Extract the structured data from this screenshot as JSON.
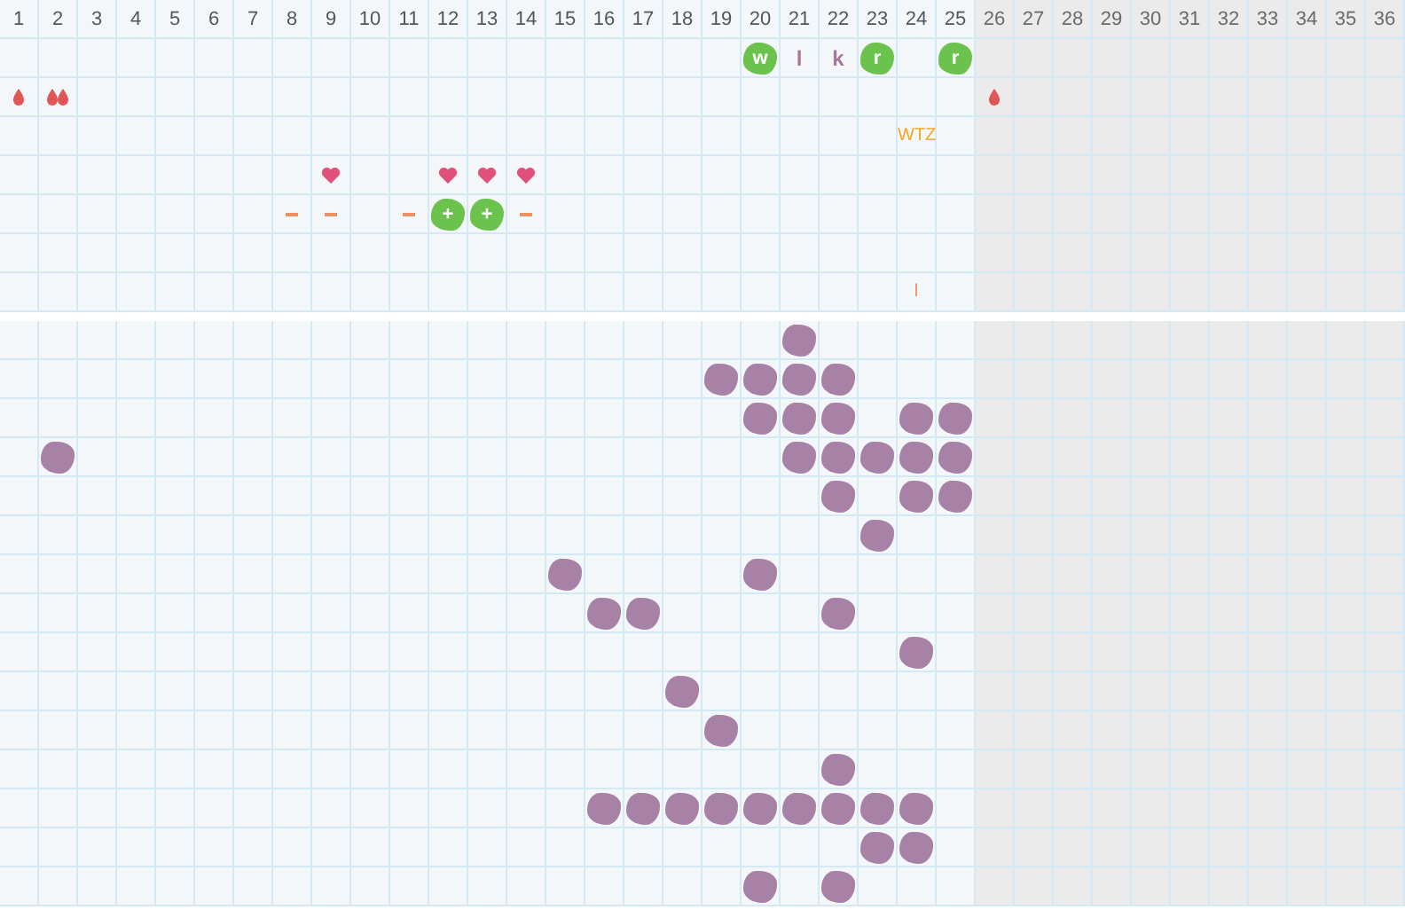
{
  "days": [
    {
      "label": "1",
      "future": false
    },
    {
      "label": "2",
      "future": false
    },
    {
      "label": "3",
      "future": false
    },
    {
      "label": "4",
      "future": false
    },
    {
      "label": "5",
      "future": false
    },
    {
      "label": "6",
      "future": false
    },
    {
      "label": "7",
      "future": false
    },
    {
      "label": "8",
      "future": false
    },
    {
      "label": "9",
      "future": false
    },
    {
      "label": "10",
      "future": false
    },
    {
      "label": "11",
      "future": false
    },
    {
      "label": "12",
      "future": false
    },
    {
      "label": "13",
      "future": false
    },
    {
      "label": "14",
      "future": false
    },
    {
      "label": "15",
      "future": false
    },
    {
      "label": "16",
      "future": false
    },
    {
      "label": "17",
      "future": false
    },
    {
      "label": "18",
      "future": false
    },
    {
      "label": "19",
      "future": false
    },
    {
      "label": "20",
      "future": false
    },
    {
      "label": "21",
      "future": false
    },
    {
      "label": "22",
      "future": false
    },
    {
      "label": "23",
      "future": false
    },
    {
      "label": "24",
      "future": false
    },
    {
      "label": "25",
      "future": false
    },
    {
      "label": "26",
      "future": true
    },
    {
      "label": "27",
      "future": true
    },
    {
      "label": "28",
      "future": true
    },
    {
      "label": "29",
      "future": true
    },
    {
      "label": "30",
      "future": true
    },
    {
      "label": "31",
      "future": true
    },
    {
      "label": "32",
      "future": true
    },
    {
      "label": "33",
      "future": true
    },
    {
      "label": "34",
      "future": true
    },
    {
      "label": "35",
      "future": true
    },
    {
      "label": "36",
      "future": true
    }
  ],
  "top_rows": [
    [
      null,
      null,
      null,
      null,
      null,
      null,
      null,
      null,
      null,
      null,
      null,
      null,
      null,
      null,
      null,
      null,
      null,
      null,
      null,
      {
        "kind": "badge",
        "text": "w"
      },
      {
        "kind": "letter",
        "text": "l"
      },
      {
        "kind": "letter",
        "text": "k"
      },
      {
        "kind": "badge",
        "text": "r"
      },
      null,
      {
        "kind": "badge",
        "text": "r"
      },
      null,
      null,
      null,
      null,
      null,
      null,
      null,
      null,
      null,
      null,
      null
    ],
    [
      {
        "kind": "drop"
      },
      {
        "kind": "double-drop"
      },
      null,
      null,
      null,
      null,
      null,
      null,
      null,
      null,
      null,
      null,
      null,
      null,
      null,
      null,
      null,
      null,
      null,
      null,
      null,
      null,
      null,
      null,
      null,
      {
        "kind": "drop"
      },
      null,
      null,
      null,
      null,
      null,
      null,
      null,
      null,
      null,
      null
    ],
    [
      null,
      null,
      null,
      null,
      null,
      null,
      null,
      null,
      null,
      null,
      null,
      null,
      null,
      null,
      null,
      null,
      null,
      null,
      null,
      null,
      null,
      null,
      null,
      {
        "kind": "note",
        "text": "WTZ"
      },
      null,
      null,
      null,
      null,
      null,
      null,
      null,
      null,
      null,
      null,
      null,
      null
    ],
    [
      null,
      null,
      null,
      null,
      null,
      null,
      null,
      null,
      {
        "kind": "heart"
      },
      null,
      null,
      {
        "kind": "heart"
      },
      {
        "kind": "heart"
      },
      {
        "kind": "heart"
      },
      null,
      null,
      null,
      null,
      null,
      null,
      null,
      null,
      null,
      null,
      null,
      null,
      null,
      null,
      null,
      null,
      null,
      null,
      null,
      null,
      null,
      null
    ],
    [
      null,
      null,
      null,
      null,
      null,
      null,
      null,
      {
        "kind": "dash"
      },
      {
        "kind": "dash"
      },
      null,
      {
        "kind": "dash"
      },
      {
        "kind": "badge",
        "text": "+"
      },
      {
        "kind": "badge",
        "text": "+"
      },
      {
        "kind": "dash"
      },
      null,
      null,
      null,
      null,
      null,
      null,
      null,
      null,
      null,
      null,
      null,
      null,
      null,
      null,
      null,
      null,
      null,
      null,
      null,
      null,
      null,
      null
    ],
    [
      null,
      null,
      null,
      null,
      null,
      null,
      null,
      null,
      null,
      null,
      null,
      null,
      null,
      null,
      null,
      null,
      null,
      null,
      null,
      null,
      null,
      null,
      null,
      null,
      null,
      null,
      null,
      null,
      null,
      null,
      null,
      null,
      null,
      null,
      null,
      null
    ],
    [
      null,
      null,
      null,
      null,
      null,
      null,
      null,
      null,
      null,
      null,
      null,
      null,
      null,
      null,
      null,
      null,
      null,
      null,
      null,
      null,
      null,
      null,
      null,
      {
        "kind": "note",
        "text": "l"
      },
      null,
      null,
      null,
      null,
      null,
      null,
      null,
      null,
      null,
      null,
      null,
      null
    ]
  ],
  "bottom_rows": [
    [
      null,
      null,
      null,
      null,
      null,
      null,
      null,
      null,
      null,
      null,
      null,
      null,
      null,
      null,
      null,
      null,
      null,
      null,
      null,
      null,
      {
        "kind": "scribble"
      },
      null,
      null,
      null,
      null,
      null,
      null,
      null,
      null,
      null,
      null,
      null,
      null,
      null,
      null,
      null
    ],
    [
      null,
      null,
      null,
      null,
      null,
      null,
      null,
      null,
      null,
      null,
      null,
      null,
      null,
      null,
      null,
      null,
      null,
      null,
      {
        "kind": "scribble"
      },
      {
        "kind": "scribble"
      },
      {
        "kind": "scribble"
      },
      {
        "kind": "scribble"
      },
      null,
      null,
      null,
      null,
      null,
      null,
      null,
      null,
      null,
      null,
      null,
      null,
      null,
      null
    ],
    [
      null,
      null,
      null,
      null,
      null,
      null,
      null,
      null,
      null,
      null,
      null,
      null,
      null,
      null,
      null,
      null,
      null,
      null,
      null,
      {
        "kind": "scribble"
      },
      {
        "kind": "scribble"
      },
      {
        "kind": "scribble"
      },
      null,
      {
        "kind": "scribble"
      },
      {
        "kind": "scribble"
      },
      null,
      null,
      null,
      null,
      null,
      null,
      null,
      null,
      null,
      null,
      null
    ],
    [
      null,
      {
        "kind": "scribble"
      },
      null,
      null,
      null,
      null,
      null,
      null,
      null,
      null,
      null,
      null,
      null,
      null,
      null,
      null,
      null,
      null,
      null,
      null,
      {
        "kind": "scribble"
      },
      {
        "kind": "scribble"
      },
      {
        "kind": "scribble"
      },
      {
        "kind": "scribble"
      },
      {
        "kind": "scribble"
      },
      null,
      null,
      null,
      null,
      null,
      null,
      null,
      null,
      null,
      null,
      null
    ],
    [
      null,
      null,
      null,
      null,
      null,
      null,
      null,
      null,
      null,
      null,
      null,
      null,
      null,
      null,
      null,
      null,
      null,
      null,
      null,
      null,
      null,
      {
        "kind": "scribble"
      },
      null,
      {
        "kind": "scribble"
      },
      {
        "kind": "scribble"
      },
      null,
      null,
      null,
      null,
      null,
      null,
      null,
      null,
      null,
      null,
      null
    ],
    [
      null,
      null,
      null,
      null,
      null,
      null,
      null,
      null,
      null,
      null,
      null,
      null,
      null,
      null,
      null,
      null,
      null,
      null,
      null,
      null,
      null,
      null,
      {
        "kind": "scribble"
      },
      null,
      null,
      null,
      null,
      null,
      null,
      null,
      null,
      null,
      null,
      null,
      null,
      null
    ],
    [
      null,
      null,
      null,
      null,
      null,
      null,
      null,
      null,
      null,
      null,
      null,
      null,
      null,
      null,
      {
        "kind": "scribble"
      },
      null,
      null,
      null,
      null,
      {
        "kind": "scribble"
      },
      null,
      null,
      null,
      null,
      null,
      null,
      null,
      null,
      null,
      null,
      null,
      null,
      null,
      null,
      null,
      null
    ],
    [
      null,
      null,
      null,
      null,
      null,
      null,
      null,
      null,
      null,
      null,
      null,
      null,
      null,
      null,
      null,
      {
        "kind": "scribble"
      },
      {
        "kind": "scribble"
      },
      null,
      null,
      null,
      null,
      {
        "kind": "scribble"
      },
      null,
      null,
      null,
      null,
      null,
      null,
      null,
      null,
      null,
      null,
      null,
      null,
      null,
      null
    ],
    [
      null,
      null,
      null,
      null,
      null,
      null,
      null,
      null,
      null,
      null,
      null,
      null,
      null,
      null,
      null,
      null,
      null,
      null,
      null,
      null,
      null,
      null,
      null,
      {
        "kind": "scribble"
      },
      null,
      null,
      null,
      null,
      null,
      null,
      null,
      null,
      null,
      null,
      null,
      null
    ],
    [
      null,
      null,
      null,
      null,
      null,
      null,
      null,
      null,
      null,
      null,
      null,
      null,
      null,
      null,
      null,
      null,
      null,
      {
        "kind": "scribble"
      },
      null,
      null,
      null,
      null,
      null,
      null,
      null,
      null,
      null,
      null,
      null,
      null,
      null,
      null,
      null,
      null,
      null,
      null
    ],
    [
      null,
      null,
      null,
      null,
      null,
      null,
      null,
      null,
      null,
      null,
      null,
      null,
      null,
      null,
      null,
      null,
      null,
      null,
      {
        "kind": "scribble"
      },
      null,
      null,
      null,
      null,
      null,
      null,
      null,
      null,
      null,
      null,
      null,
      null,
      null,
      null,
      null,
      null,
      null
    ],
    [
      null,
      null,
      null,
      null,
      null,
      null,
      null,
      null,
      null,
      null,
      null,
      null,
      null,
      null,
      null,
      null,
      null,
      null,
      null,
      null,
      null,
      {
        "kind": "scribble"
      },
      null,
      null,
      null,
      null,
      null,
      null,
      null,
      null,
      null,
      null,
      null,
      null,
      null,
      null
    ],
    [
      null,
      null,
      null,
      null,
      null,
      null,
      null,
      null,
      null,
      null,
      null,
      null,
      null,
      null,
      null,
      {
        "kind": "scribble"
      },
      {
        "kind": "scribble"
      },
      {
        "kind": "scribble"
      },
      {
        "kind": "scribble"
      },
      {
        "kind": "scribble"
      },
      {
        "kind": "scribble"
      },
      {
        "kind": "scribble"
      },
      {
        "kind": "scribble"
      },
      {
        "kind": "scribble"
      },
      null,
      null,
      null,
      null,
      null,
      null,
      null,
      null,
      null,
      null,
      null,
      null
    ],
    [
      null,
      null,
      null,
      null,
      null,
      null,
      null,
      null,
      null,
      null,
      null,
      null,
      null,
      null,
      null,
      null,
      null,
      null,
      null,
      null,
      null,
      null,
      {
        "kind": "scribble"
      },
      {
        "kind": "scribble"
      },
      null,
      null,
      null,
      null,
      null,
      null,
      null,
      null,
      null,
      null,
      null,
      null
    ],
    [
      null,
      null,
      null,
      null,
      null,
      null,
      null,
      null,
      null,
      null,
      null,
      null,
      null,
      null,
      null,
      null,
      null,
      null,
      null,
      {
        "kind": "scribble"
      },
      null,
      {
        "kind": "scribble"
      },
      null,
      null,
      null,
      null,
      null,
      null,
      null,
      null,
      null,
      null,
      null,
      null,
      null,
      null
    ]
  ]
}
